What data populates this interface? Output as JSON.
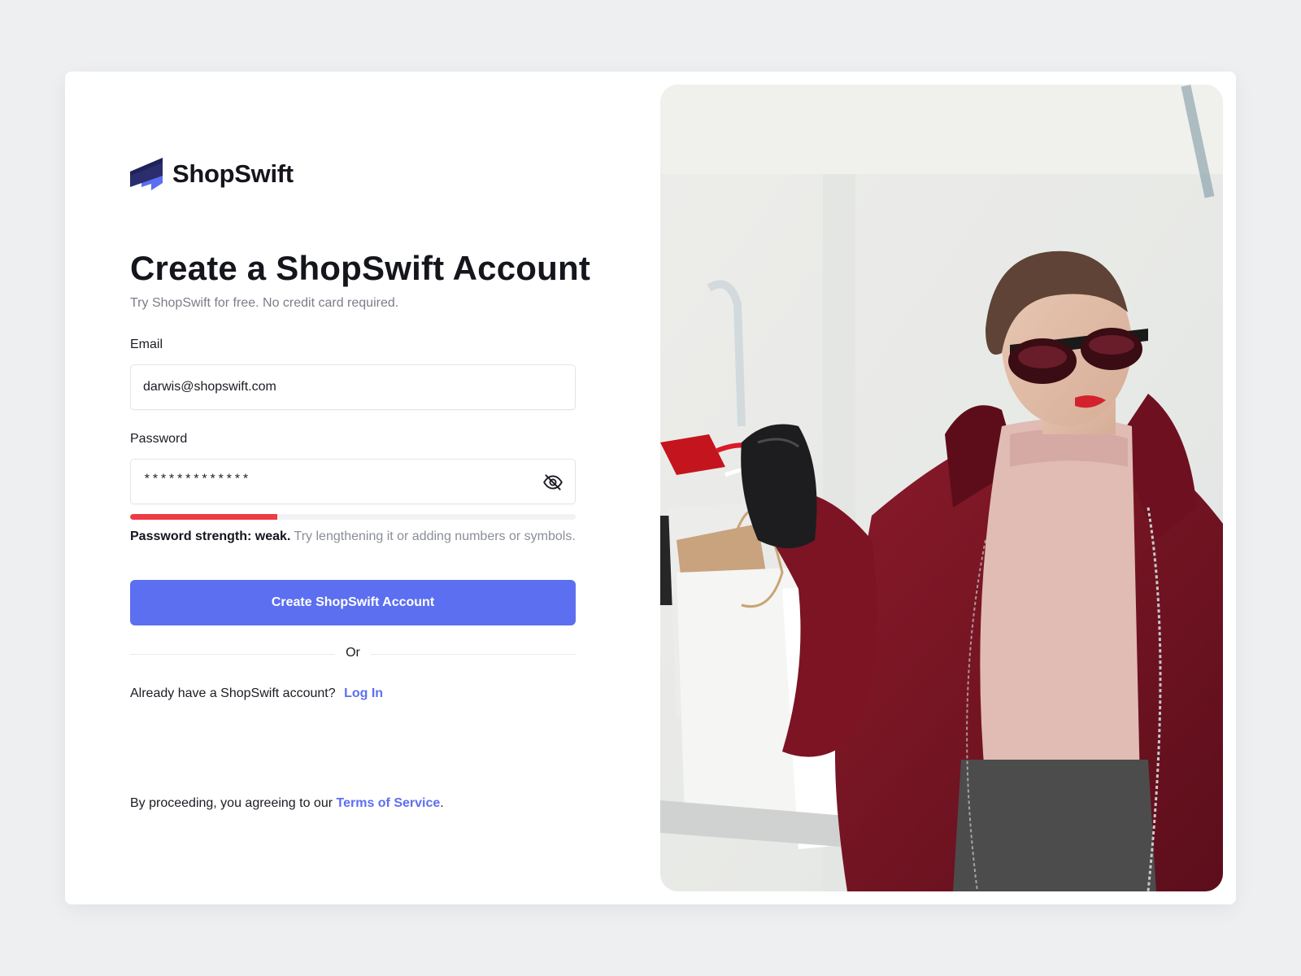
{
  "brand": {
    "name": "ShopSwift",
    "logo_icon": "stacked-flag-logo",
    "colors": {
      "dark": "#1f2257",
      "mid": "#3d46a8",
      "light": "#5c6ff0"
    }
  },
  "form": {
    "title": "Create a ShopSwift Account",
    "subtitle": "Try ShopSwift for free. No credit card required.",
    "email": {
      "label": "Email",
      "value": "darwis@shopswift.com"
    },
    "password": {
      "label": "Password",
      "masked_value": "*************",
      "toggle_icon": "eye-off-icon"
    },
    "strength": {
      "level": 0.33,
      "color": "#ef3b45",
      "label": "Password strength: weak.",
      "hint": " Try lengthening it or adding numbers or symbols."
    },
    "submit_label": "Create ShopSwift Account",
    "divider_text": "Or",
    "login_prompt": "Already have a ShopSwift account?",
    "login_link": "Log In",
    "terms_prefix": "By proceeding, you agreeing to our ",
    "terms_link": "Terms of Service",
    "terms_suffix": "."
  },
  "theme": {
    "accent": "#5c6ff0",
    "background": "#eeeff1"
  }
}
